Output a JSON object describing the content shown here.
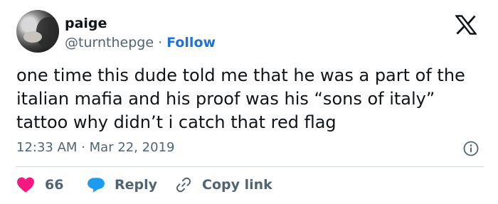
{
  "profile": {
    "name": "paige",
    "handle": "@turnthepge",
    "separator": "·",
    "follow_label": "Follow"
  },
  "tweet": {
    "text": "one time this dude told me that he was a part of the italian mafia and his proof was his “sons of italy” tattoo why didn’t i catch that red flag",
    "time": "12:33 AM",
    "separator": "·",
    "date": "Mar 22, 2019"
  },
  "actions": {
    "like_count": "66",
    "reply_label": "Reply",
    "copy_link_label": "Copy link"
  },
  "icons": {
    "brand": "x-logo-icon",
    "info": "info-icon",
    "like": "heart-icon",
    "reply": "speech-bubble-icon",
    "copy": "link-icon"
  },
  "colors": {
    "like": "#f91880",
    "reply": "#1d9bf0",
    "follow": "#1d72d8",
    "muted_text": "#536471"
  }
}
